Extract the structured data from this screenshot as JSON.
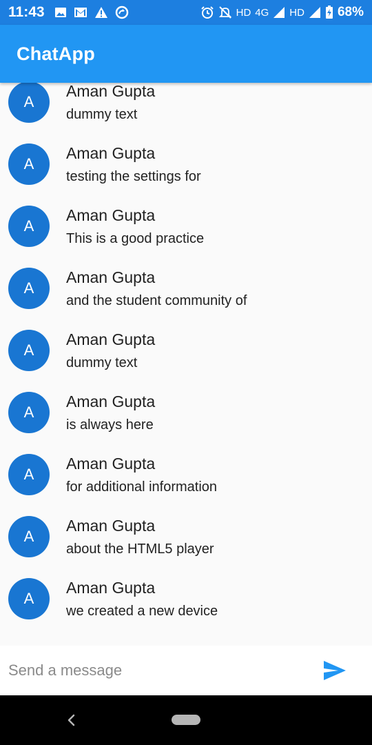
{
  "status_bar": {
    "time": "11:43",
    "left_icons": [
      "image-icon",
      "gmail-icon",
      "warning-icon",
      "sync-icon"
    ],
    "hd1": "HD",
    "network": "4G",
    "hd2": "HD",
    "battery": "68%"
  },
  "app_bar": {
    "title": "ChatApp"
  },
  "messages": [
    {
      "avatar": "A",
      "sender": "Aman Gupta",
      "text": "dummy text"
    },
    {
      "avatar": "A",
      "sender": "Aman Gupta",
      "text": "testing the settings for"
    },
    {
      "avatar": "A",
      "sender": "Aman Gupta",
      "text": "This is a good practice"
    },
    {
      "avatar": "A",
      "sender": "Aman Gupta",
      "text": "and the student community of"
    },
    {
      "avatar": "A",
      "sender": "Aman Gupta",
      "text": "dummy text"
    },
    {
      "avatar": "A",
      "sender": "Aman Gupta",
      "text": "is always here"
    },
    {
      "avatar": "A",
      "sender": "Aman Gupta",
      "text": "for additional information"
    },
    {
      "avatar": "A",
      "sender": "Aman Gupta",
      "text": "about the HTML5 player"
    },
    {
      "avatar": "A",
      "sender": "Aman Gupta",
      "text": "we created a new device"
    }
  ],
  "composer": {
    "placeholder": "Send a message",
    "value": ""
  },
  "colors": {
    "status_bar": "#1d7fe0",
    "app_bar": "#2196f3",
    "avatar": "#1976d2",
    "send_icon": "#2196f3"
  }
}
